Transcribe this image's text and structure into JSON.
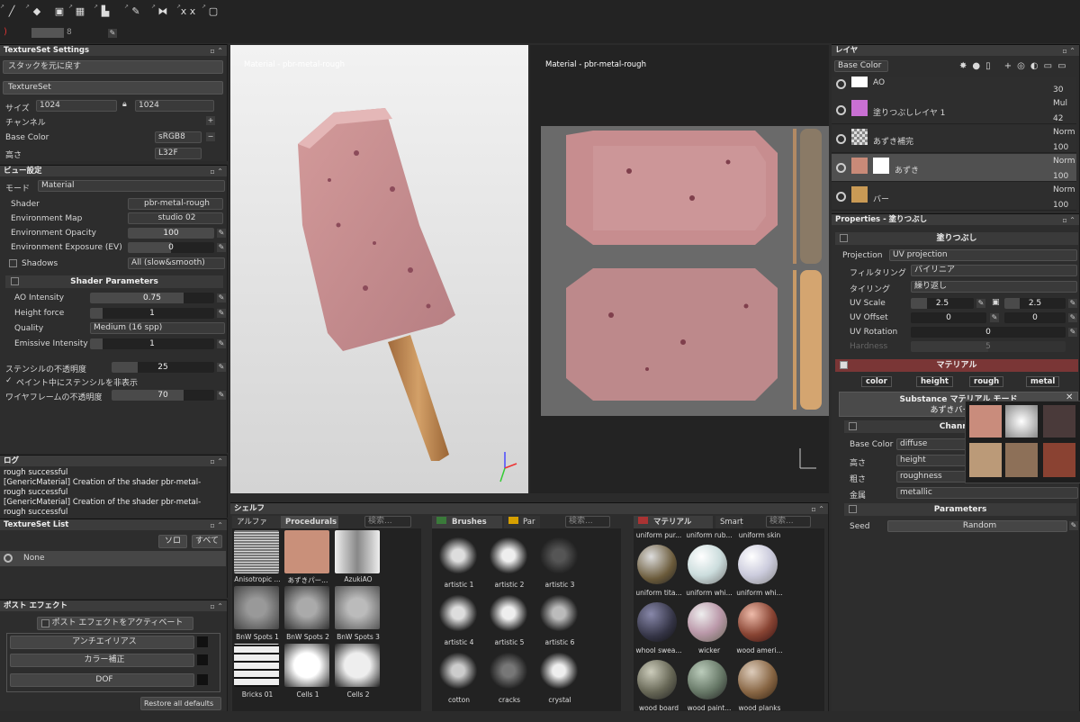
{
  "toolbar": {
    "brush_size": "8",
    "tool_icons": [
      "paint-brush-icon",
      "eraser-icon",
      "projection-icon",
      "geometry-mask-icon",
      "fill-icon",
      "smudge-icon",
      "picker-icon",
      "symmetry-icon",
      "xx-icon",
      "camera-icon"
    ]
  },
  "textureset_settings": {
    "title": "TextureSet Settings",
    "undo_stack": "スタックを元に戻す",
    "textureset": "TextureSet",
    "size_label": "サイズ",
    "size_w": "1024",
    "size_h": "1024",
    "channel_label": "チャンネル",
    "base_color": "Base Color",
    "base_color_fmt": "sRGB8",
    "height": "高さ",
    "height_fmt": "L32F"
  },
  "view_settings": {
    "title": "ビュー設定",
    "mode_label": "モード",
    "mode_value": "Material",
    "shader_label": "Shader",
    "shader_value": "pbr-metal-rough",
    "env_map_label": "Environment Map",
    "env_map_value": "studio 02",
    "env_opacity_label": "Environment Opacity",
    "env_opacity_value": "100",
    "env_exposure_label": "Environment Exposure (EV)",
    "env_exposure_value": "0",
    "shadows_label": "Shadows",
    "shadows_value": "All (slow&smooth)",
    "shader_params": "Shader Parameters",
    "ao_label": "AO Intensity",
    "ao_value": "0.75",
    "height_force_label": "Height force",
    "height_force_value": "1",
    "quality_label": "Quality",
    "quality_value": "Medium (16 spp)",
    "emissive_label": "Emissive Intensity",
    "emissive_value": "1",
    "stencil_opacity_label": "ステンシルの不透明度",
    "stencil_opacity_value": "25",
    "hide_stencil": "ペイント中にステンシルを非表示",
    "wire_label": "ワイヤフレームの不透明度",
    "wire_value": "70"
  },
  "log": {
    "title": "ログ",
    "lines": [
      "rough successful",
      "[GenericMaterial] Creation of the shader pbr-metal-",
      "rough successful",
      "[GenericMaterial] Creation of the shader pbr-metal-",
      "rough successful"
    ]
  },
  "textureset_list": {
    "title": "TextureSet List",
    "solo": "ソロ",
    "all": "すべて",
    "item": "None"
  },
  "post_effects": {
    "title": "ポスト エフェクト",
    "activate": "ポスト エフェクトをアクティベート",
    "items": [
      "アンチエイリアス",
      "カラー補正",
      "DOF"
    ],
    "restore": "Restore all defaults"
  },
  "viewport3d": {
    "label": "Material - pbr-metal-rough"
  },
  "viewport2d": {
    "label": "Material - pbr-metal-rough"
  },
  "shelf": {
    "title": "シェルフ",
    "tabs1": [
      "アルファ",
      "Procedurals"
    ],
    "search": "検索...",
    "tabs2": [
      "Brushes",
      "Par"
    ],
    "tabs3": [
      "マテリアル",
      "Smart"
    ],
    "procedurals": [
      "Anisotropic ...",
      "あずきパー...",
      "AzukiAO",
      "BnW Spots 1",
      "BnW Spots 2",
      "BnW Spots 3",
      "Bricks 01",
      "Cells 1",
      "Cells 2"
    ],
    "brushes": [
      "artistic 1",
      "artistic 2",
      "artistic 3",
      "artistic 4",
      "artistic 5",
      "artistic 6",
      "cotton",
      "cracks",
      "crystal"
    ],
    "materials": [
      "uniform pur...",
      "uniform rub...",
      "uniform skin",
      "uniform tita...",
      "uniform whi...",
      "uniform whi...",
      "whool swea...",
      "wicker",
      "wood ameri...",
      "wood board",
      "wood paint...",
      "wood planks"
    ]
  },
  "layers": {
    "title": "レイヤ",
    "channel": "Base Color",
    "items": [
      {
        "name": "AO",
        "blend": "",
        "opacity": "30"
      },
      {
        "name": "塗りつぶしレイヤ 1",
        "blend": "Mul",
        "opacity": "42"
      },
      {
        "name": "あずき補完",
        "blend": "Norm",
        "opacity": "100"
      },
      {
        "name": "あずき",
        "blend": "Norm",
        "opacity": "100"
      },
      {
        "name": "バー",
        "blend": "Norm",
        "opacity": "100"
      }
    ]
  },
  "properties": {
    "title": "Properties - 塗りつぶし",
    "fill": "塗りつぶし",
    "projection_label": "Projection",
    "projection_value": "UV projection",
    "filter_label": "フィルタリング",
    "filter_value": "バイリニア",
    "tiling_label": "タイリング",
    "tiling_value": "繰り返し",
    "uvscale_label": "UV Scale",
    "uvscale_u": "2.5",
    "uvscale_v": "2.5",
    "uvoffset_label": "UV Offset",
    "uvoffset_u": "0",
    "uvoffset_v": "0",
    "uvrot_label": "UV Rotation",
    "uvrot_value": "0",
    "hardness_label": "Hardness",
    "hardness_value": "5",
    "material": "マテリアル",
    "chans": [
      "color",
      "height",
      "rough",
      "metal"
    ],
    "substance_mode": "Substance マテリアル モード",
    "substance_name": "あずきバーマテ",
    "channels": "Channels",
    "ch_rows": [
      {
        "label": "Base Color",
        "value": "diffuse"
      },
      {
        "label": "高さ",
        "value": "height"
      },
      {
        "label": "粗さ",
        "value": "roughness"
      },
      {
        "label": "金属",
        "value": "metallic"
      }
    ],
    "parameters": "Parameters",
    "seed_label": "Seed",
    "seed_value": "Random"
  }
}
